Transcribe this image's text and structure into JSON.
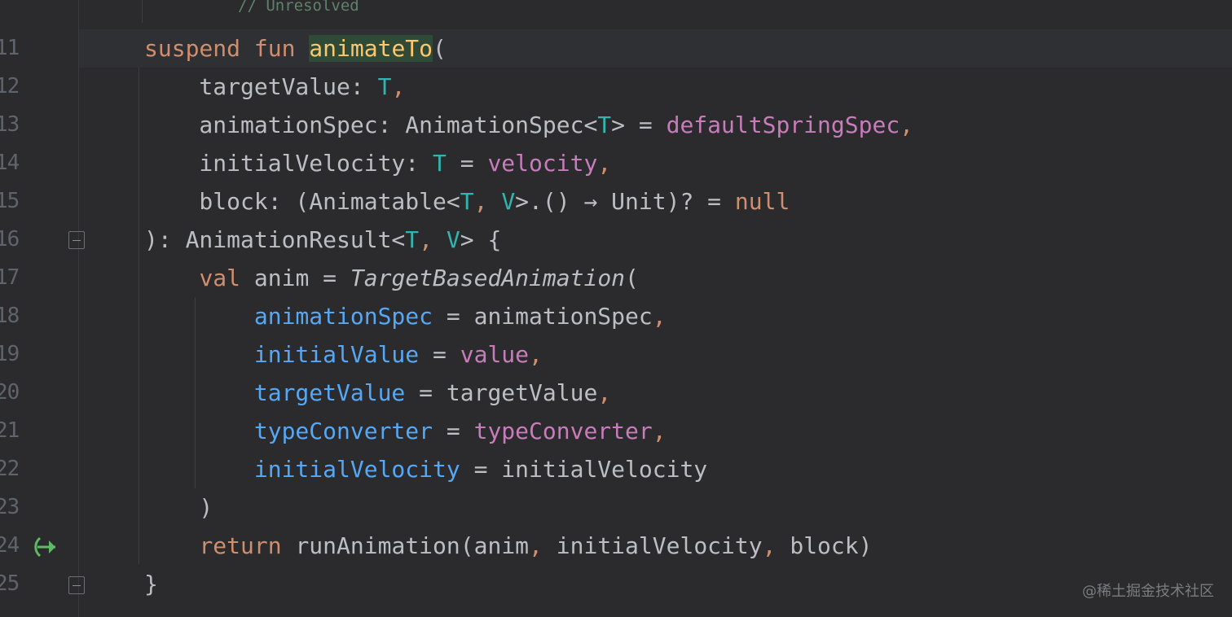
{
  "editor": {
    "top_comment": "// Unresolved",
    "lines": [
      {
        "num": "11",
        "tokens": [
          {
            "t": "suspend ",
            "c": "kw"
          },
          {
            "t": "fun ",
            "c": "kw"
          },
          {
            "t": "animateTo",
            "c": "hl"
          },
          {
            "t": "(",
            "c": "pl"
          }
        ]
      },
      {
        "num": "12",
        "tokens": [
          {
            "t": "    targetValue: ",
            "c": "pl"
          },
          {
            "t": "T",
            "c": "tp"
          },
          {
            "t": ",",
            "c": "kw"
          }
        ]
      },
      {
        "num": "13",
        "tokens": [
          {
            "t": "    animationSpec: AnimationSpec<",
            "c": "pl"
          },
          {
            "t": "T",
            "c": "tp"
          },
          {
            "t": "> = ",
            "c": "pl"
          },
          {
            "t": "defaultSpringSpec",
            "c": "pr"
          },
          {
            "t": ",",
            "c": "kw"
          }
        ]
      },
      {
        "num": "14",
        "tokens": [
          {
            "t": "    initialVelocity: ",
            "c": "pl"
          },
          {
            "t": "T",
            "c": "tp"
          },
          {
            "t": " = ",
            "c": "pl"
          },
          {
            "t": "velocity",
            "c": "pr"
          },
          {
            "t": ",",
            "c": "kw"
          }
        ]
      },
      {
        "num": "15",
        "tokens": [
          {
            "t": "    block: (Animatable<",
            "c": "pl"
          },
          {
            "t": "T",
            "c": "tp"
          },
          {
            "t": ", ",
            "c": "kw"
          },
          {
            "t": "V",
            "c": "tp"
          },
          {
            "t": ">.() → Unit)? = ",
            "c": "pl"
          },
          {
            "t": "null",
            "c": "kw"
          }
        ]
      },
      {
        "num": "16",
        "tokens": [
          {
            "t": "): AnimationResult<",
            "c": "pl"
          },
          {
            "t": "T",
            "c": "tp"
          },
          {
            "t": ", ",
            "c": "kw"
          },
          {
            "t": "V",
            "c": "tp"
          },
          {
            "t": "> {",
            "c": "pl"
          }
        ]
      },
      {
        "num": "17",
        "tokens": [
          {
            "t": "    ",
            "c": "pl"
          },
          {
            "t": "val ",
            "c": "kw"
          },
          {
            "t": "anim = ",
            "c": "pl"
          },
          {
            "t": "TargetBasedAnimation",
            "c": "it"
          },
          {
            "t": "(",
            "c": "pl"
          }
        ]
      },
      {
        "num": "18",
        "tokens": [
          {
            "t": "        ",
            "c": "pl"
          },
          {
            "t": "animationSpec",
            "c": "nm"
          },
          {
            "t": " = animationSpec",
            "c": "pl"
          },
          {
            "t": ",",
            "c": "kw"
          }
        ]
      },
      {
        "num": "19",
        "tokens": [
          {
            "t": "        ",
            "c": "pl"
          },
          {
            "t": "initialValue",
            "c": "nm"
          },
          {
            "t": " = ",
            "c": "pl"
          },
          {
            "t": "value",
            "c": "pr"
          },
          {
            "t": ",",
            "c": "kw"
          }
        ]
      },
      {
        "num": "20",
        "tokens": [
          {
            "t": "        ",
            "c": "pl"
          },
          {
            "t": "targetValue",
            "c": "nm"
          },
          {
            "t": " = targetValue",
            "c": "pl"
          },
          {
            "t": ",",
            "c": "kw"
          }
        ]
      },
      {
        "num": "21",
        "tokens": [
          {
            "t": "        ",
            "c": "pl"
          },
          {
            "t": "typeConverter",
            "c": "nm"
          },
          {
            "t": " = ",
            "c": "pl"
          },
          {
            "t": "typeConverter",
            "c": "pr"
          },
          {
            "t": ",",
            "c": "kw"
          }
        ]
      },
      {
        "num": "22",
        "tokens": [
          {
            "t": "        ",
            "c": "pl"
          },
          {
            "t": "initialVelocity",
            "c": "nm"
          },
          {
            "t": " = initialVelocity",
            "c": "pl"
          }
        ]
      },
      {
        "num": "23",
        "tokens": [
          {
            "t": "    )",
            "c": "pl"
          }
        ]
      },
      {
        "num": "24",
        "tokens": [
          {
            "t": "    ",
            "c": "pl"
          },
          {
            "t": "return ",
            "c": "kw"
          },
          {
            "t": "runAnimation(anim",
            "c": "pl"
          },
          {
            "t": ", ",
            "c": "kw"
          },
          {
            "t": "initialVelocity",
            "c": "pl"
          },
          {
            "t": ", ",
            "c": "kw"
          },
          {
            "t": "block)",
            "c": "pl"
          }
        ]
      },
      {
        "num": "25",
        "tokens": [
          {
            "t": "}",
            "c": "pl"
          }
        ]
      }
    ]
  },
  "gutter": {
    "fold_icons": [
      "fold-collapse-icon",
      "fold-end-icon"
    ],
    "run_icon": "recursive-call-icon"
  },
  "watermark": "@稀土掘金技术社区",
  "colors": {
    "background": "#2b2b2d",
    "keyword": "#cf8e6d",
    "type_param": "#2fb6b0",
    "property": "#c77dbb",
    "named_arg": "#56a8f5",
    "plain": "#bcbec4",
    "line_number": "#5f636b"
  }
}
